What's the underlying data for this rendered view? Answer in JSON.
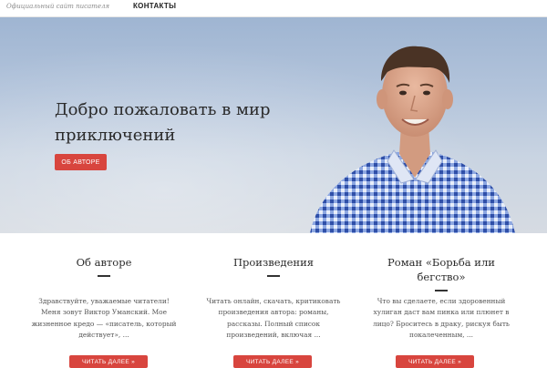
{
  "header": {
    "tagline": "Официальный сайт писателя",
    "nav_contacts": "КОНТАКТЫ"
  },
  "hero": {
    "title": "Добро пожаловать в мир приключений",
    "button_label": "ОБ АВТОРЕ"
  },
  "columns": [
    {
      "title": "Об авторе",
      "text": "Здравствуйте, уважаемые читатели! Меня зовут Виктор Уманский. Мое жизненное кредо — «писатель, который действует»,  ...",
      "button_label": "ЧИТАТЬ ДАЛЕЕ »"
    },
    {
      "title": "Произведения",
      "text": "Читать онлайн, скачать, критиковать произведения автора: романы, рассказы. Полный список произведений, включая ...",
      "button_label": "ЧИТАТЬ ДАЛЕЕ »"
    },
    {
      "title": "Роман «Борьба или бегство»",
      "text": "Что вы сделаете, если здоровенный хулиган даст вам пинка или плюнет в лицо? Броситесь в драку, рискуя быть покалеченным, ...",
      "button_label": "ЧИТАТЬ ДАЛЕЕ »"
    }
  ],
  "colors": {
    "accent": "#d8453e",
    "shirt": "#4a6cc0"
  }
}
